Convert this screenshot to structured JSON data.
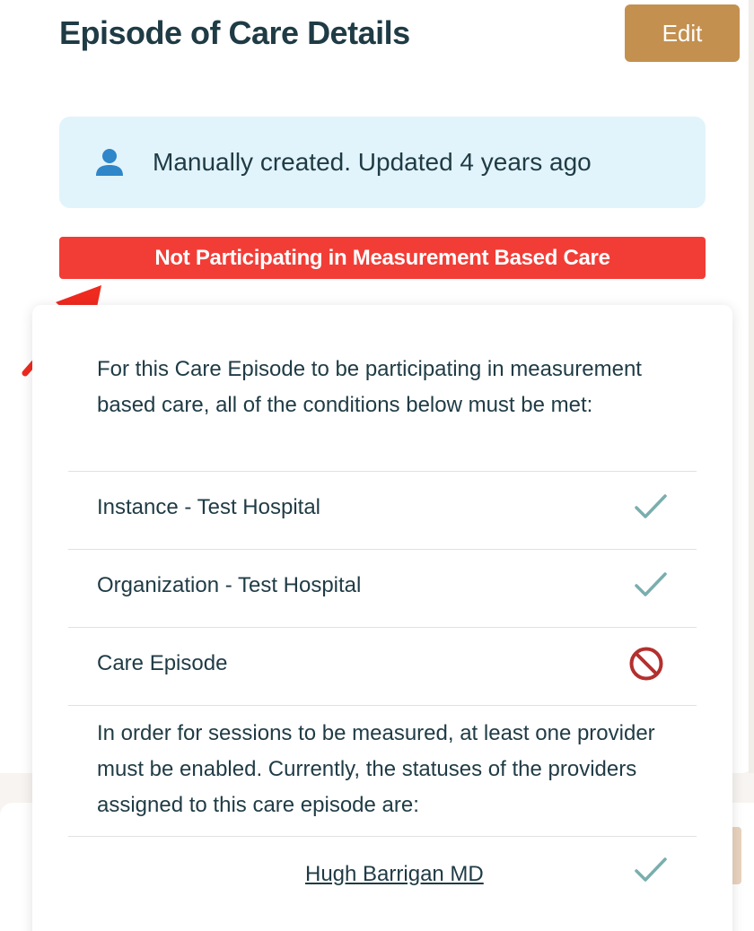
{
  "header": {
    "title": "Episode of Care Details",
    "edit_label": "Edit"
  },
  "info_banner": {
    "icon": "user-icon",
    "text": "Manually created. Updated 4 years ago"
  },
  "status_bar": {
    "text": "Not Participating in Measurement Based Care",
    "color": "#f23d36"
  },
  "popover": {
    "intro": "For this Care Episode to be participating in measurement based care, all of the conditions below must be met:",
    "conditions": [
      {
        "label": "Instance - Test Hospital",
        "status": "met",
        "icon": "checkmark-icon"
      },
      {
        "label": "Organization - Test Hospital",
        "status": "met",
        "icon": "checkmark-icon"
      },
      {
        "label": "Care Episode",
        "status": "not-met",
        "icon": "prohibited-icon"
      }
    ],
    "providers_intro": "In order for sessions to be measured, at least one provider must be enabled. Currently, the statuses of the providers assigned to this care episode are:",
    "providers": [
      {
        "name": "Hugh Barrigan MD",
        "status": "enabled",
        "icon": "checkmark-icon"
      }
    ]
  },
  "colors": {
    "accent": "#c4904f",
    "danger": "#f23d36",
    "check": "#7aaeae",
    "prohibited": "#b3302e",
    "text": "#1f3b45",
    "info_bg": "#e2f4fb"
  }
}
